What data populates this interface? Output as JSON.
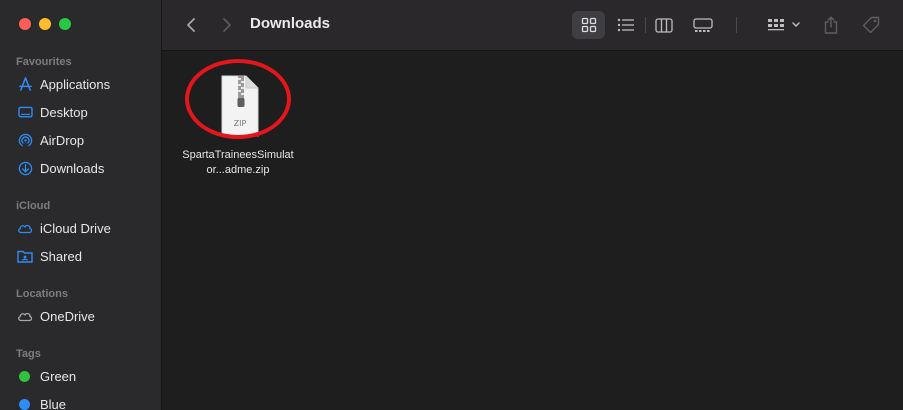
{
  "window": {
    "title": "Downloads",
    "controls": [
      "close",
      "minimize",
      "zoom"
    ]
  },
  "sidebar": {
    "sections": [
      {
        "title": "Favourites",
        "items": [
          {
            "label": "Applications",
            "icon": "applications-icon"
          },
          {
            "label": "Desktop",
            "icon": "desktop-icon"
          },
          {
            "label": "AirDrop",
            "icon": "airdrop-icon"
          },
          {
            "label": "Downloads",
            "icon": "downloads-icon"
          }
        ]
      },
      {
        "title": "iCloud",
        "items": [
          {
            "label": "iCloud Drive",
            "icon": "cloud-icon"
          },
          {
            "label": "Shared",
            "icon": "shared-folder-icon"
          }
        ]
      },
      {
        "title": "Locations",
        "items": [
          {
            "label": "OneDrive",
            "icon": "cloud-icon"
          }
        ]
      },
      {
        "title": "Tags",
        "items": [
          {
            "label": "Green",
            "color": "#30c23d"
          },
          {
            "label": "Blue",
            "color": "#2f8cf5"
          }
        ]
      }
    ]
  },
  "toolbar": {
    "view_modes": [
      "icons",
      "list",
      "columns",
      "gallery"
    ],
    "active_view": "icons",
    "group_label": "group-icon",
    "share_icon": "share-icon",
    "tag_icon": "tag-icon"
  },
  "files": [
    {
      "name": "SpartaTraineesSimulator...adme.zip",
      "type_label": "ZIP",
      "highlighted": true
    }
  ],
  "colors": {
    "accent": "#2f8cf5",
    "highlight": "#e3161b"
  }
}
